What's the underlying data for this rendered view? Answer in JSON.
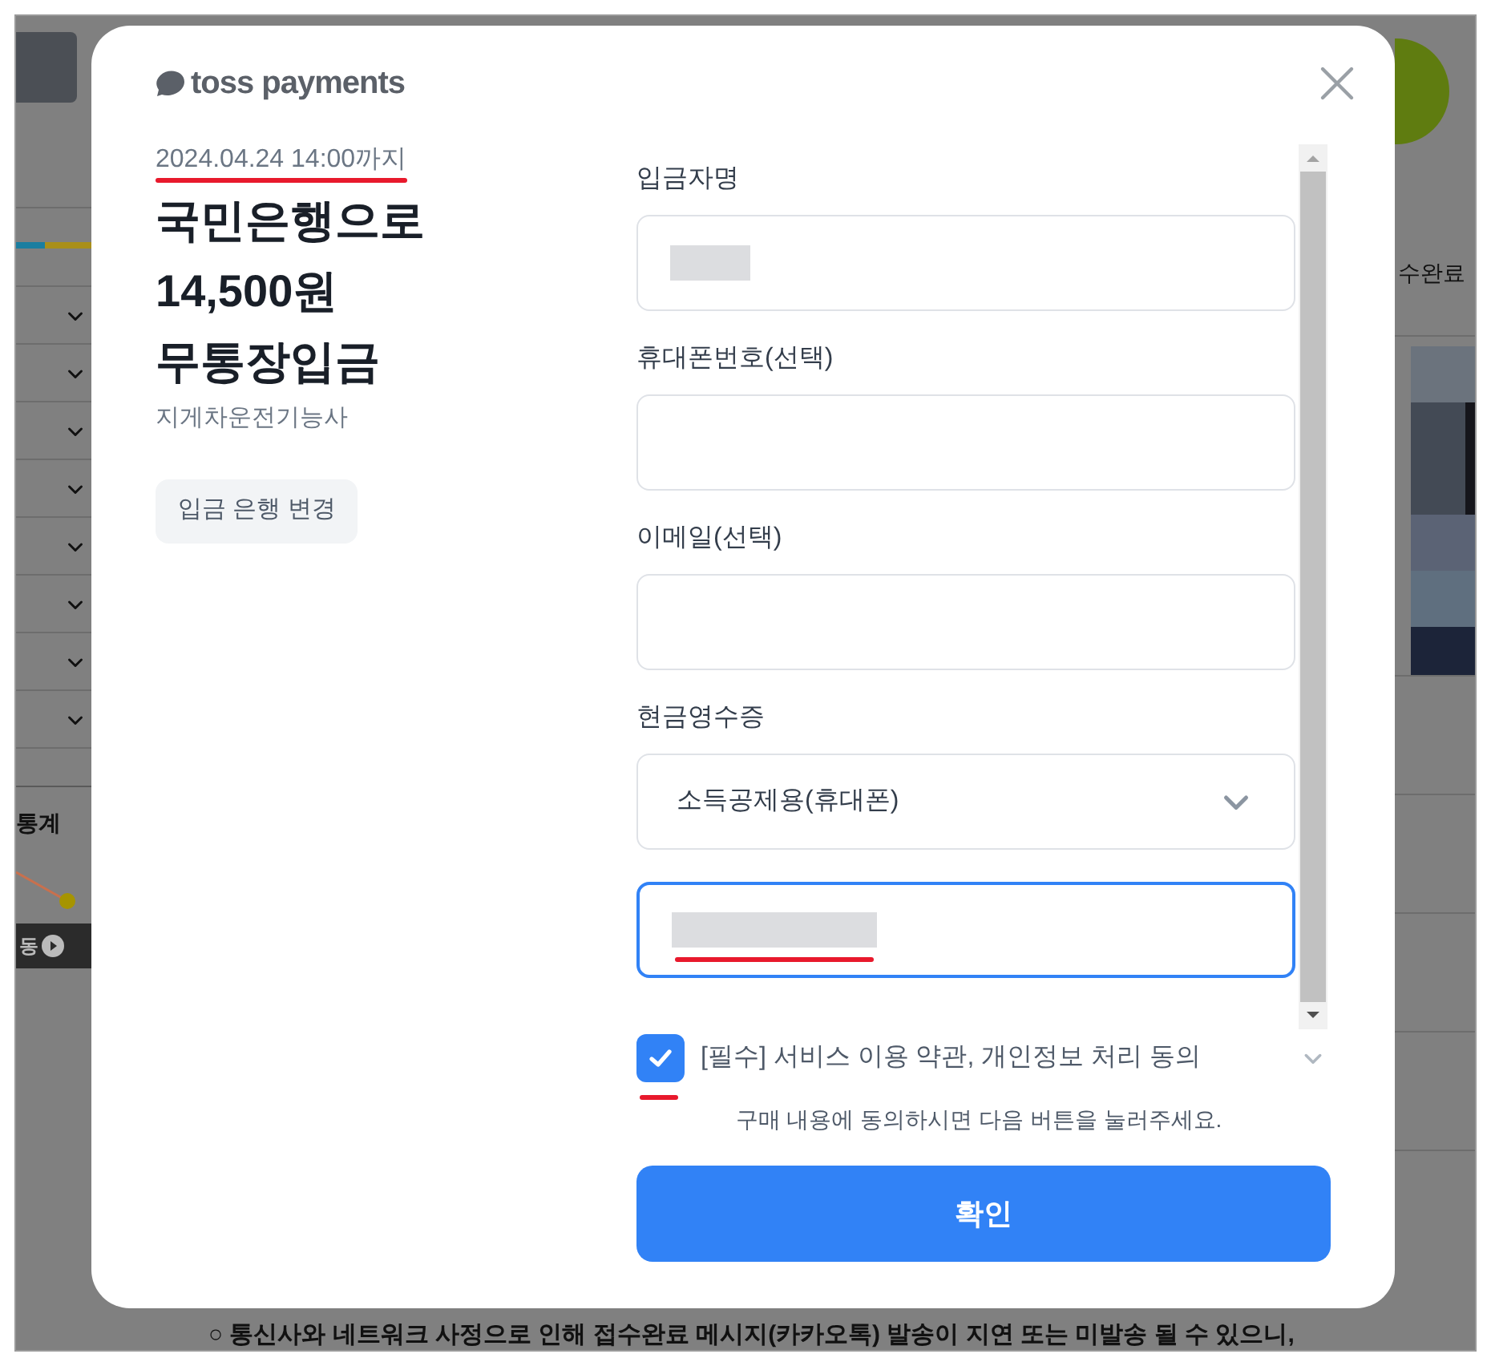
{
  "backdrop": {
    "progress": {
      "level": 0.38
    },
    "left_caption": "통계",
    "left_bar_label": "동",
    "right_caption": "수완료",
    "bottom_text": "○ 통신사와 네트워크 사정으로 인해 접수완료 메시지(카카오톡) 발송이 지연 또는 미발송 될 수 있으니,"
  },
  "modal": {
    "logo": "toss payments",
    "deadline": "2024.04.24 14:00까지",
    "headline": [
      "국민은행으로",
      "14,500원",
      "무통장입금"
    ],
    "merchant": "지게차운전기능사",
    "change_bank_button": "입금 은행 변경",
    "fields": [
      {
        "kind": "text",
        "label": "입금자명",
        "redacted": true,
        "focused": false
      },
      {
        "kind": "text",
        "label": "휴대폰번호(선택)",
        "redacted": false,
        "focused": false
      },
      {
        "kind": "text",
        "label": "이메일(선택)",
        "redacted": false,
        "focused": false
      },
      {
        "kind": "select",
        "label": "현금영수증",
        "value": "소득공제용(휴대폰)"
      },
      {
        "kind": "text",
        "redacted": true,
        "focused": true
      }
    ],
    "agreement": {
      "checked": true,
      "tag": "[필수]",
      "text": "서비스 이용 약관, 개인정보 처리 동의"
    },
    "note": "구매 내용에 동의하시면 다음 버튼을 눌러주세요.",
    "confirm_button": "확인"
  }
}
